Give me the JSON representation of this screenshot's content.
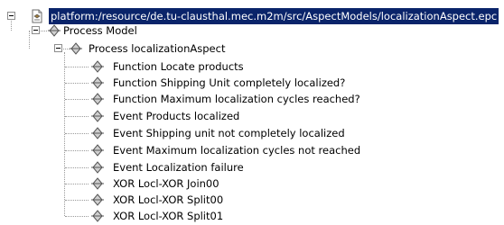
{
  "tree": {
    "root": {
      "label": "platform:/resource/de.tu-clausthal.mec.m2m/src/AspectModels/localizationAspect.epc"
    },
    "model": {
      "label": "Process Model"
    },
    "process": {
      "label": "Process localizationAspect"
    },
    "items": [
      {
        "label": "Function Locate products"
      },
      {
        "label": "Function Shipping Unit completely localized?"
      },
      {
        "label": "Function Maximum localization cycles reached?"
      },
      {
        "label": "Event Products localized"
      },
      {
        "label": "Event Shipping unit not completely localized"
      },
      {
        "label": "Event Maximum localization cycles not reached"
      },
      {
        "label": "Event Localization failure"
      },
      {
        "label": "XOR Locl-XOR Join00"
      },
      {
        "label": "XOR Locl-XOR Split00"
      },
      {
        "label": "XOR Locl-XOR Split01"
      }
    ]
  }
}
